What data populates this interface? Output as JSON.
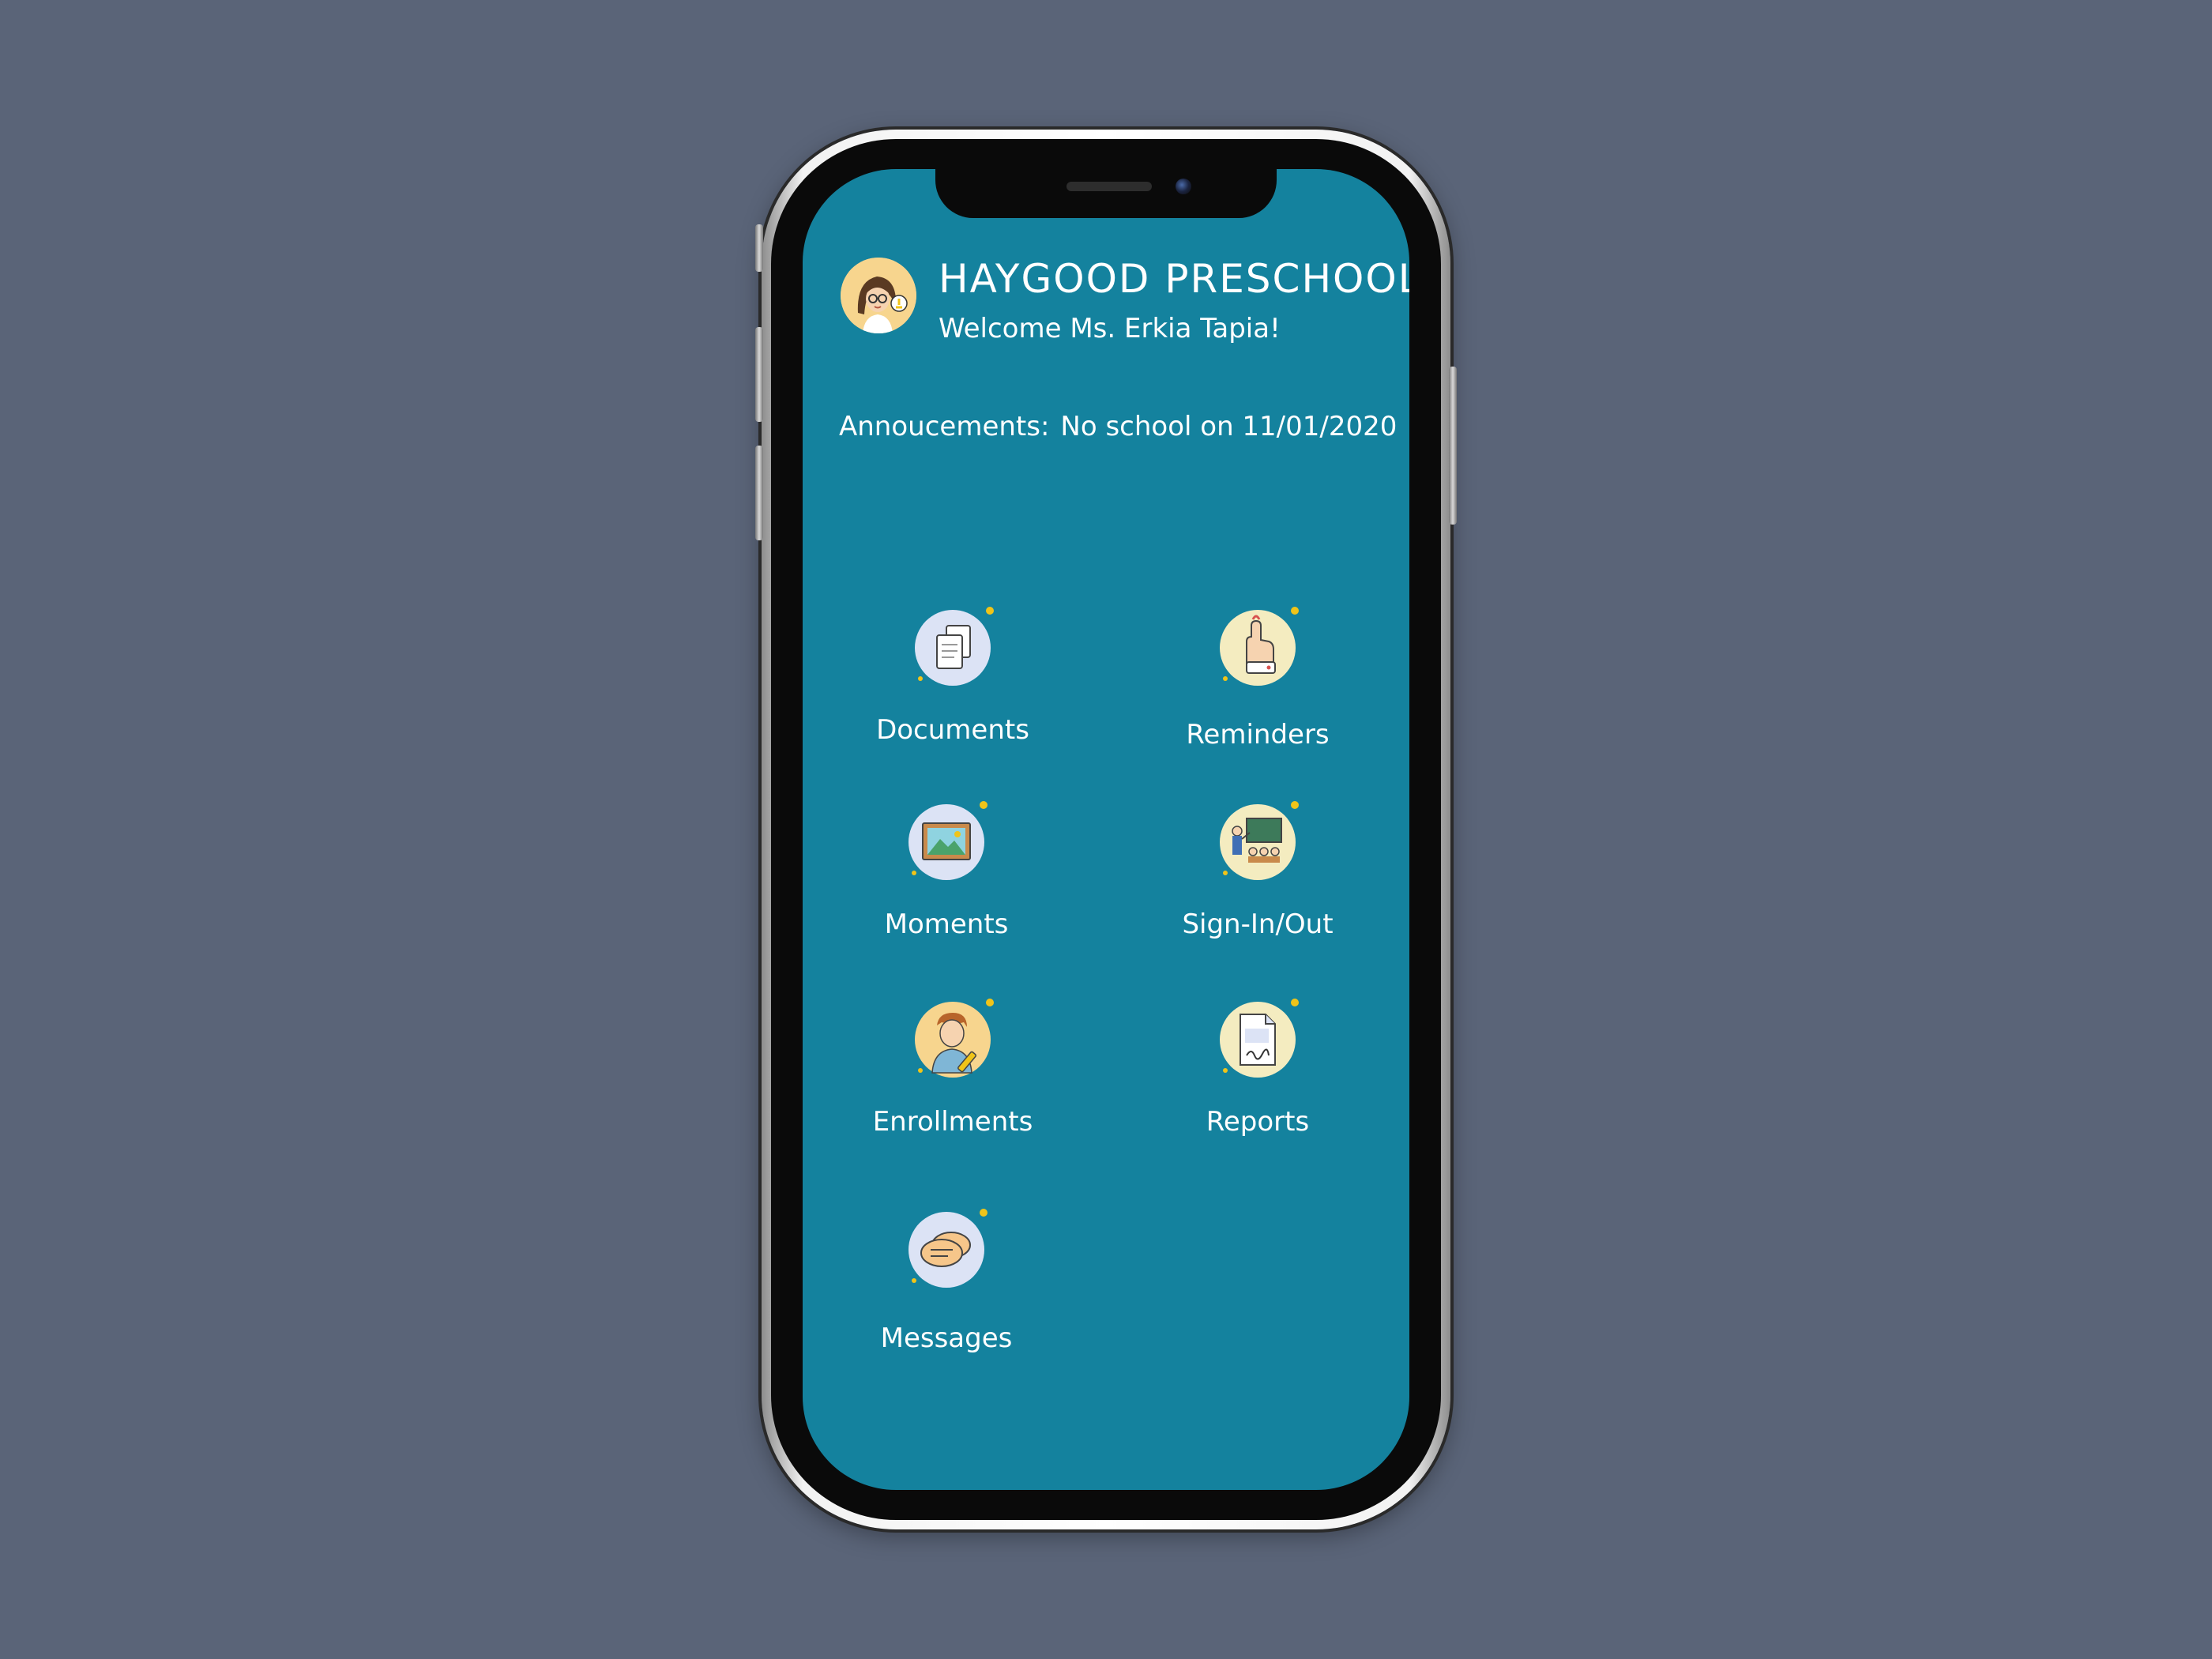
{
  "app": {
    "school_name": "HAYGOOD PRESCHOOL",
    "welcome": "Welcome Ms. Erkia Tapia!"
  },
  "announcement": {
    "label": "Annoucements:",
    "text": "No school on 11/01/2020"
  },
  "menu": [
    {
      "label": "Documents",
      "icon": "documents-icon"
    },
    {
      "label": "Reminders",
      "icon": "reminder-finger-icon"
    },
    {
      "label": "Moments",
      "icon": "photo-frame-icon"
    },
    {
      "label": "Sign-In/Out",
      "icon": "teacher-board-icon"
    },
    {
      "label": "Enrollments",
      "icon": "person-pencil-icon"
    },
    {
      "label": "Reports",
      "icon": "signed-report-icon"
    },
    {
      "label": "Messages",
      "icon": "chat-bubbles-icon"
    }
  ],
  "colors": {
    "background": "#5a6478",
    "screen": "#14829e",
    "text": "#ffffff",
    "accent_dot": "#f0c419"
  }
}
